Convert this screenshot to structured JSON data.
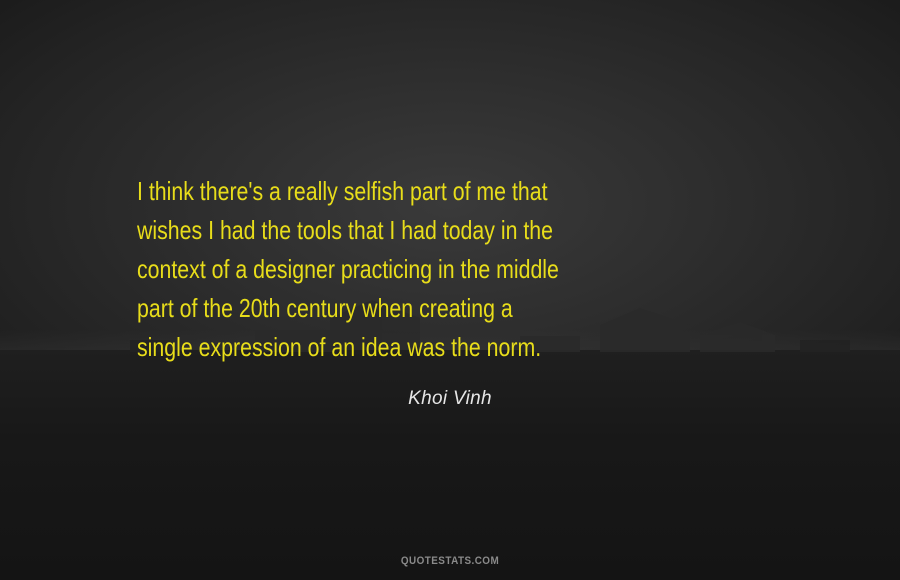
{
  "quote": {
    "lines": [
      "I think there's a really selfish part of me that",
      "wishes I had the tools that I had today in the",
      "context of a designer practicing in the middle",
      "part of the 20th century when creating a",
      "single expression of an idea was the norm."
    ],
    "color": "#e8dd1a"
  },
  "author": "Khoi Vinh",
  "watermark": "QUOTESTATS.COM",
  "background": {
    "description_color": "#2a2a2a"
  }
}
